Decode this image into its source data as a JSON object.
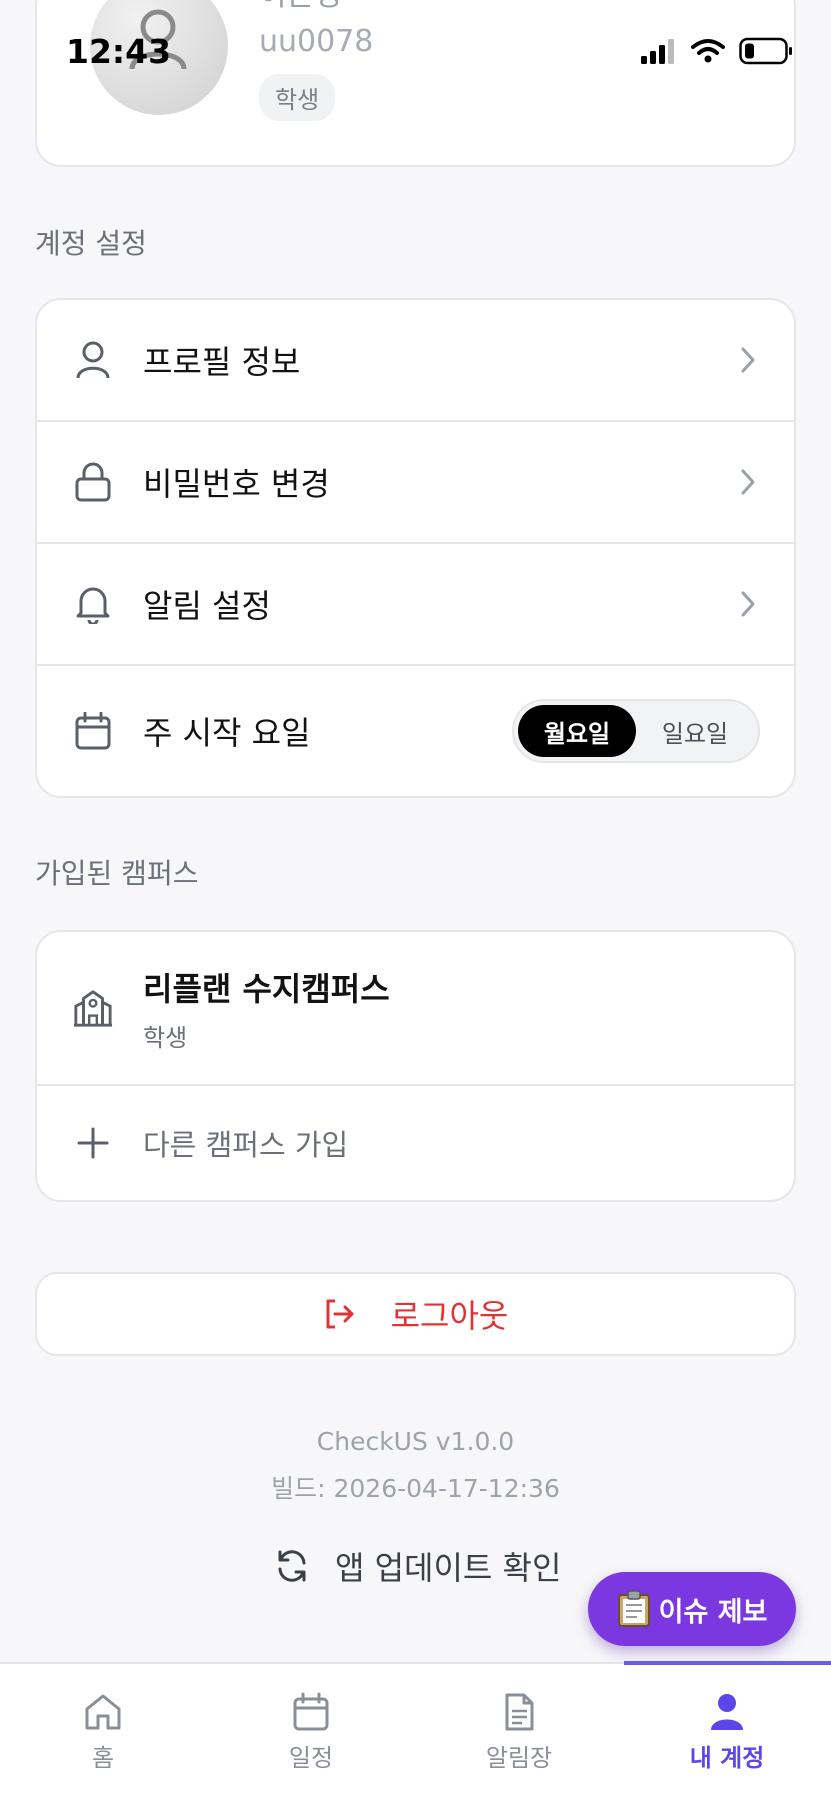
{
  "status_bar": {
    "time": "12:43"
  },
  "profile": {
    "name": "이은성",
    "id": "uu0078",
    "role": "학생"
  },
  "account_settings": {
    "title": "계정 설정",
    "items": [
      {
        "label": "프로필 정보",
        "icon": "user-icon"
      },
      {
        "label": "비밀번호 변경",
        "icon": "lock-icon"
      },
      {
        "label": "알림 설정",
        "icon": "bell-icon"
      }
    ],
    "week_start": {
      "label": "주 시작 요일",
      "options": [
        "월요일",
        "일요일"
      ],
      "selected": "월요일"
    }
  },
  "campuses": {
    "title": "가입된 캠퍼스",
    "items": [
      {
        "name": "리플랜 수지캠퍼스",
        "role": "학생",
        "icon": "school-icon"
      }
    ],
    "join_label": "다른 캠퍼스 가입"
  },
  "logout_label": "로그아웃",
  "version": "CheckUS v1.0.0",
  "build": "빌드: 2026-04-17-12:36",
  "update_label": "앱 업데이트 확인",
  "fab_label": "이슈 제보",
  "tabs": [
    {
      "label": "홈",
      "icon": "home-icon"
    },
    {
      "label": "일정",
      "icon": "calendar-icon"
    },
    {
      "label": "알림장",
      "icon": "document-icon"
    },
    {
      "label": "내 계정",
      "icon": "account-icon"
    }
  ],
  "active_tab": "내 계정",
  "colors": {
    "accent": "#5b46e8",
    "fab": "#7b38e0",
    "logout": "#e03434"
  }
}
